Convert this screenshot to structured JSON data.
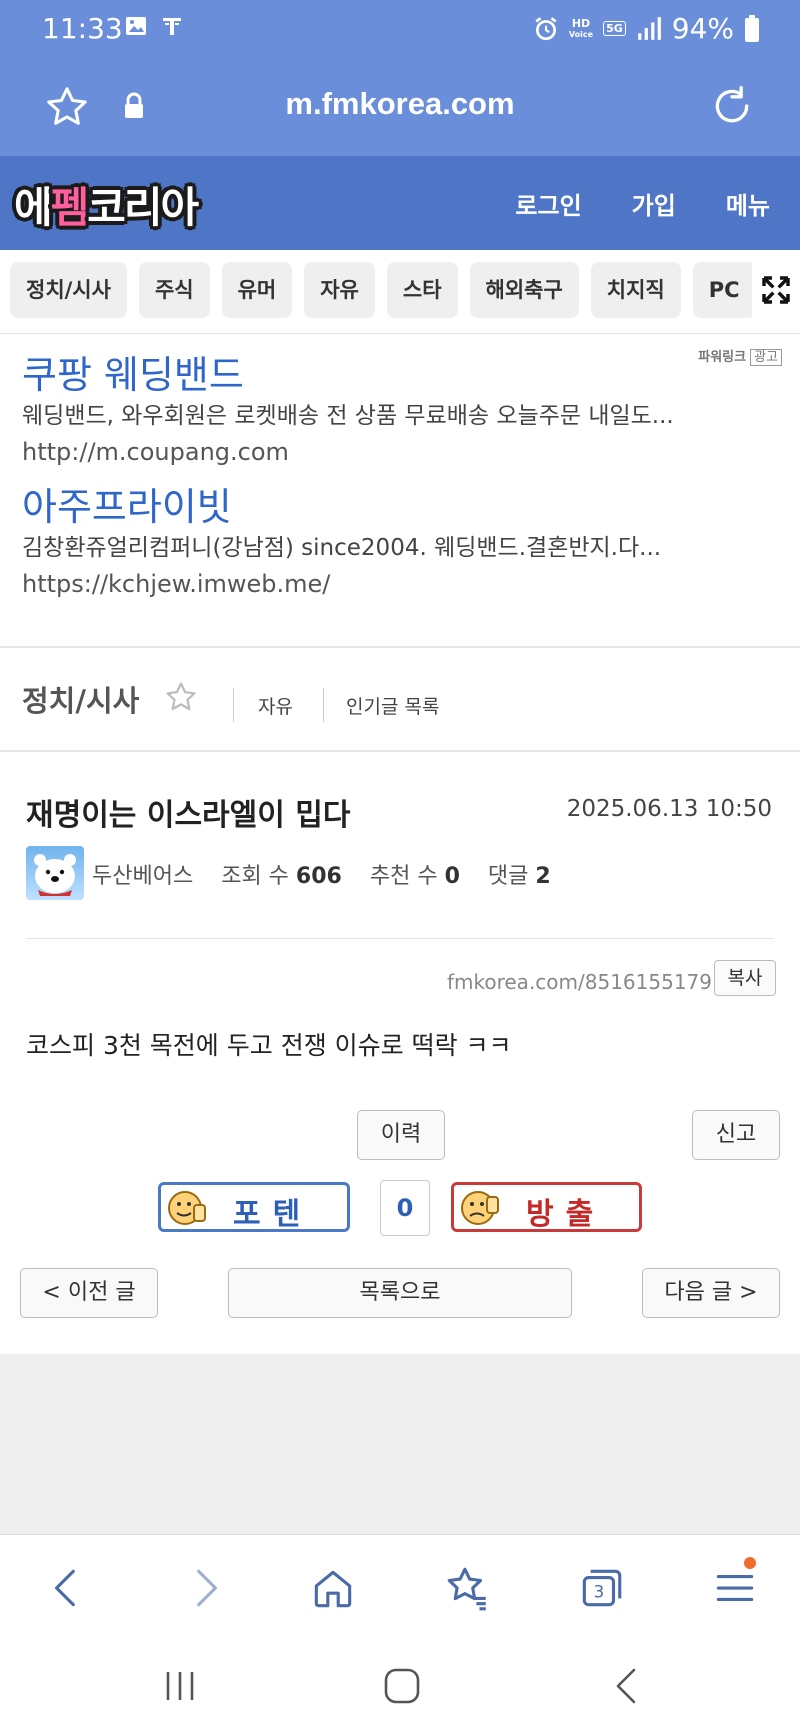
{
  "status": {
    "time": "11:33",
    "battery": "94%",
    "hd": "HD",
    "voice": "Voice",
    "net": "5G"
  },
  "browser": {
    "url": "m.fmkorea.com"
  },
  "site": {
    "logo_part1": "에",
    "logo_part2": "펨",
    "logo_part3": "코리아",
    "nav": {
      "login": "로그인",
      "join": "가입",
      "menu": "메뉴"
    }
  },
  "categories": [
    "정치/시사",
    "주식",
    "유머",
    "자유",
    "스타",
    "해외축구",
    "치지직",
    "PC"
  ],
  "ads": {
    "powerlink": "파워링크",
    "ad_tag": "광고",
    "items": [
      {
        "title": "쿠팡 웨딩밴드",
        "desc": "웨딩밴드, 와우회원은 로켓배송 전 상품 무료배송 오늘주문 내일도...",
        "link": "http://m.coupang.com"
      },
      {
        "title": "아주프라이빗",
        "desc": "김창환쥬얼리컴퍼니(강남점) since2004. 웨딩밴드.결혼반지.다...",
        "link": "https://kchjew.imweb.me/"
      }
    ]
  },
  "board": {
    "title": "정치/시사",
    "links": [
      "자유",
      "인기글 목록"
    ]
  },
  "post": {
    "title": "재명이는 이스라엘이 밉다",
    "date": "2025.06.13 10:50",
    "author": "두산베어스",
    "views_label": "조회 수",
    "views": "606",
    "recommend_label": "추천 수",
    "recommend": "0",
    "comments_label": "댓글",
    "comments": "2",
    "short_url": "fmkorea.com/8516155179",
    "copy": "복사",
    "body": "코스피 3천 목전에 두고 전쟁 이슈로 떡락 ㅋㅋ"
  },
  "actions": {
    "history": "이력",
    "report": "신고",
    "vote_up": "포텐",
    "vote_count": "0",
    "vote_down": "방출",
    "prev": "< 이전 글",
    "list": "목록으로",
    "next": "다음 글 >"
  },
  "tabs_count": "3",
  "colors": {
    "browser_bar": "#6b8edb",
    "site_header": "#4f75c6",
    "link_blue": "#2f66c9",
    "vote_up": "#4a79c8",
    "vote_down": "#c93a3a"
  }
}
